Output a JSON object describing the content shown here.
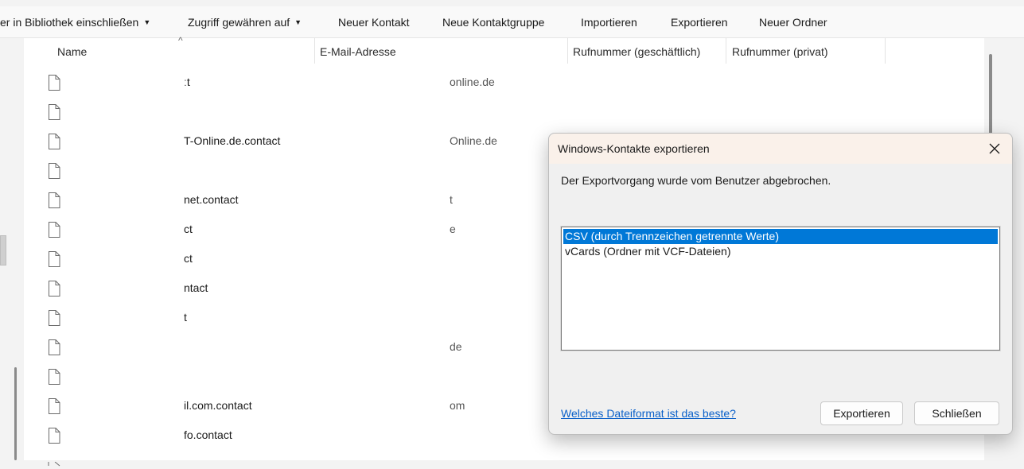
{
  "toolbar": {
    "include_library": "er in Bibliothek einschließen",
    "grant_access": "Zugriff gewähren auf",
    "new_contact": "Neuer Kontakt",
    "new_contact_group": "Neue Kontaktgruppe",
    "import": "Importieren",
    "export": "Exportieren",
    "new_folder": "Neuer Ordner"
  },
  "columns": {
    "name": "Name",
    "email": "E-Mail-Adresse",
    "phone_business": "Rufnummer (geschäftlich)",
    "phone_private": "Rufnummer (privat)"
  },
  "rows": [
    {
      "name": "ːt",
      "email": "online.de"
    },
    {
      "name": "",
      "email": ""
    },
    {
      "name": "T-Online.de.contact",
      "email": "Online.de"
    },
    {
      "name": "",
      "email": ""
    },
    {
      "name": "net.contact",
      "email": "t"
    },
    {
      "name": "ct",
      "email": "e"
    },
    {
      "name": "ct",
      "email": ""
    },
    {
      "name": "ntact",
      "email": ""
    },
    {
      "name": "t",
      "email": ""
    },
    {
      "name": "",
      "email": "de"
    },
    {
      "name": "",
      "email": ""
    },
    {
      "name": "il.com.contact",
      "email": "om"
    },
    {
      "name": "fo.contact",
      "email": ""
    }
  ],
  "dialog": {
    "title": "Windows-Kontakte exportieren",
    "message": "Der Exportvorgang wurde vom Benutzer abgebrochen.",
    "formats": [
      "CSV (durch Trennzeichen getrennte Werte)",
      "vCards (Ordner mit VCF-Dateien)"
    ],
    "selected_index": 0,
    "help_link": "Welches Dateiformat ist das beste?",
    "export_button": "Exportieren",
    "close_button": "Schließen"
  },
  "colors": {
    "selection": "#0078d7",
    "link": "#0a60c9",
    "dialog_title_bg": "#faf1ea"
  }
}
